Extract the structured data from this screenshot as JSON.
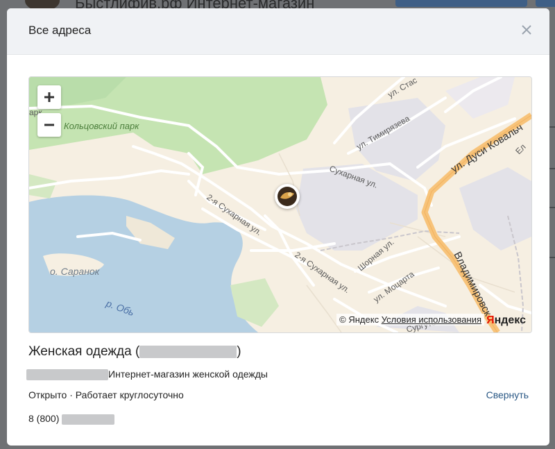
{
  "modal": {
    "title": "Все адреса",
    "close_icon": "close-icon"
  },
  "map": {
    "labels": {
      "park": "Кольцовский парк",
      "park_left": "арк",
      "stasova": "ул. Стас",
      "timiryazeva": "ул. Тимирязева",
      "dusi": "ул. Дуси Ковальч",
      "el": "Ел",
      "sukharnaya": "Сухарная ул.",
      "sukharnaya2a": "2-я Сухарная ул.",
      "sukharnaya2b": "2-я Сухарная ул.",
      "shornaya": "Шорная ул.",
      "motsarta": "ул. Моцарта",
      "vladimirovskaya": "Владимировск",
      "surgut": "Сургутс",
      "saranok": "о. Саранок",
      "ob": "р. Обь"
    },
    "attribution": "© Яндекс",
    "terms_link": "Условия использования",
    "logo_letter": "Я",
    "logo_text": "ндекс",
    "zoom_in": "+",
    "zoom_out": "−"
  },
  "place": {
    "name_prefix": "Женская одежда (",
    "name_suffix": ")",
    "category": "Интернет-магазин женской одежды",
    "status": "Открыто · Работает круглосуточно",
    "phone_prefix": "8 (800)",
    "collapse_label": "Свернуть"
  },
  "background": {
    "title": "Быстлифив.рф Интернет-магазин"
  },
  "colors": {
    "link": "#2a5885",
    "header_bg": "#f0f2f5",
    "water": "#b5d0e3",
    "park": "#c5e4b2",
    "highway": "#f7c37a"
  }
}
